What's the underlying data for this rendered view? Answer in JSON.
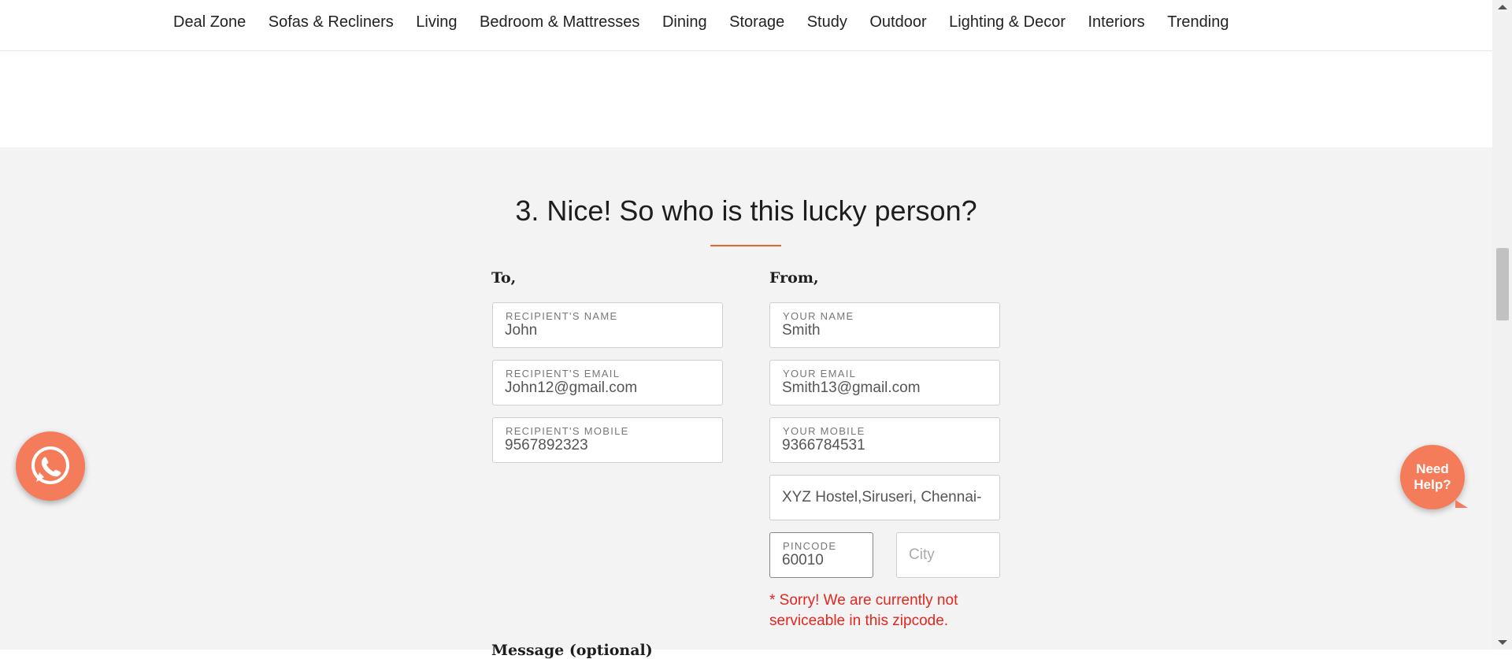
{
  "nav": {
    "items": [
      "Deal Zone",
      "Sofas & Recliners",
      "Living",
      "Bedroom & Mattresses",
      "Dining",
      "Storage",
      "Study",
      "Outdoor",
      "Lighting & Decor",
      "Interiors",
      "Trending"
    ]
  },
  "section": {
    "heading": "3. Nice! So who is this lucky person?",
    "to_label": "To,",
    "from_label": "From,",
    "message_label": "Message (optional)"
  },
  "recipient": {
    "name_label": "RECIPIENT'S NAME",
    "name_value": "John",
    "email_label": "RECIPIENT'S EMAIL",
    "email_value": "John12@gmail.com",
    "mobile_label": "RECIPIENT'S MOBILE",
    "mobile_value": "9567892323"
  },
  "sender": {
    "name_label": "YOUR NAME",
    "name_value": "Smith",
    "email_label": "YOUR EMAIL",
    "email_value": "Smith13@gmail.com",
    "mobile_label": "YOUR MOBILE",
    "mobile_value": "9366784531",
    "address_value": "XYZ Hostel,Siruseri, Chennai-",
    "pincode_label": "PINCODE",
    "pincode_value": "60010",
    "city_placeholder": "City"
  },
  "error_text": "* Sorry! We are currently not serviceable in this zipcode.",
  "help": {
    "line1": "Need",
    "line2": "Help?"
  },
  "colors": {
    "accent": "#e3682e",
    "fab": "#f47c5a",
    "error": "#e3261f",
    "section_bg": "#f3f3f3"
  },
  "icons": {
    "whatsapp": "whatsapp-icon"
  }
}
